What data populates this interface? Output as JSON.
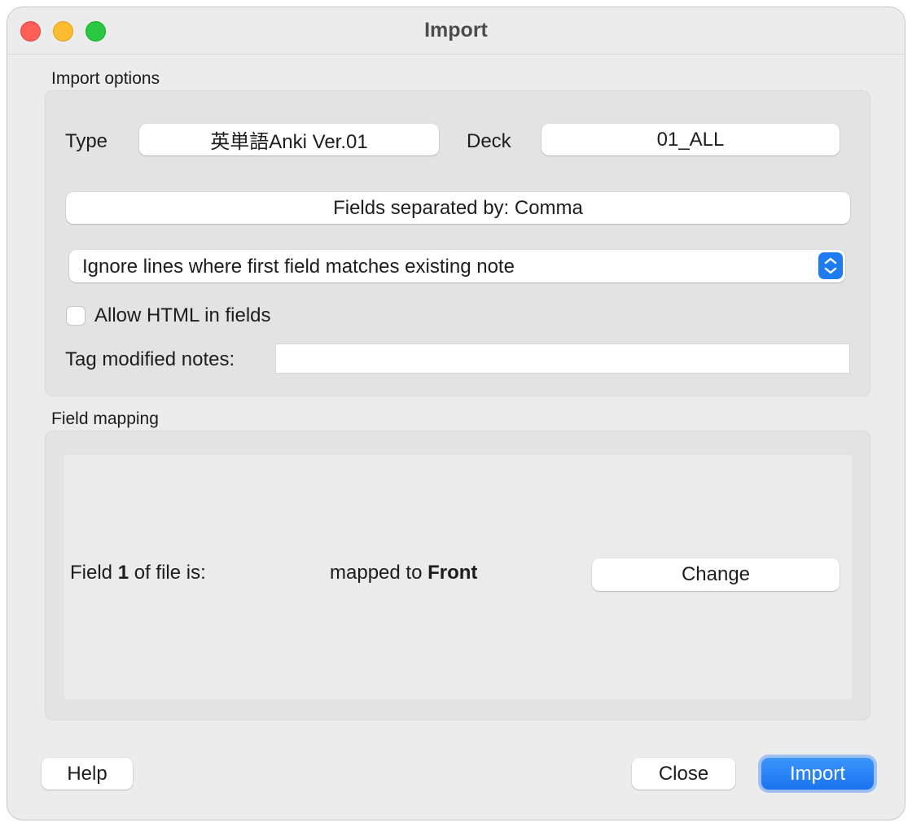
{
  "window": {
    "title": "Import"
  },
  "import_options": {
    "section_label": "Import options",
    "type_label": "Type",
    "type_value": "英単語Anki Ver.01",
    "deck_label": "Deck",
    "deck_value": "01_ALL",
    "separator_button": "Fields separated by: Comma",
    "duplicate_mode": "Ignore lines where first field matches existing note",
    "allow_html_label": "Allow HTML in fields",
    "allow_html_checked": false,
    "tag_label": "Tag modified notes:",
    "tag_value": ""
  },
  "field_mapping": {
    "section_label": "Field mapping",
    "row": {
      "prefix": "Field ",
      "field_number": "1",
      "suffix": " of file is:",
      "mapped_prefix": "mapped to ",
      "mapped_field": "Front",
      "change_button": "Change"
    }
  },
  "footer": {
    "help_button": "Help",
    "close_button": "Close",
    "import_button": "Import"
  },
  "colors": {
    "accent": "#1a73f0",
    "close": "#ff5f57",
    "minimize": "#febc2e",
    "maximize": "#28c840"
  }
}
